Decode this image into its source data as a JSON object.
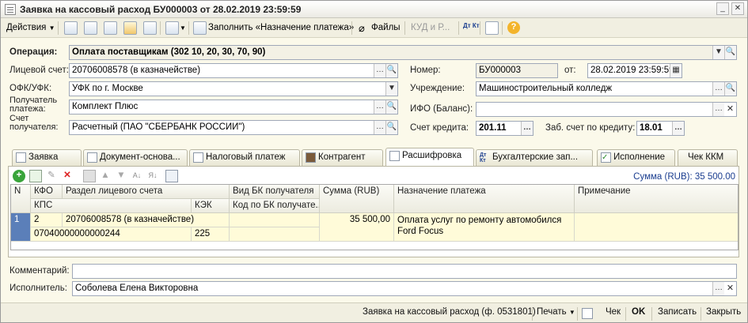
{
  "window": {
    "title": "Заявка на кассовый расход БУ000003 от 28.02.2019 23:59:59"
  },
  "toolbar": {
    "actions_label": "Действия",
    "fill_label": "Заполнить «Назначение платежа»",
    "files_label": "Файлы",
    "kud_label": "КУД и Р...",
    "dt_kt_label": "Дт Кт",
    "help_label": "?"
  },
  "form": {
    "operation_label": "Операция:",
    "operation_value": "Оплата поставщикам (302 10, 20, 30, 70, 90)",
    "account_label": "Лицевой счет:",
    "account_value": "20706008578 (в казначействе)",
    "number_label": "Номер:",
    "number_value": "БУ000003",
    "from_label": "от:",
    "date_value": "28.02.2019 23:59:59",
    "ofk_label": "ОФК/УФК:",
    "ofk_value": "УФК по г. Москве",
    "institution_label": "Учреждение:",
    "institution_value": "Машиностроительный колледж",
    "payee_label_1": "Получатель",
    "payee_label_2": "платежа:",
    "payee_value": "Комплект Плюс",
    "ifo_label": "ИФО (Баланс):",
    "ifo_value": "",
    "payee_acc_label_1": "Счет",
    "payee_acc_label_2": "получателя:",
    "payee_acc_value": "Расчетный (ПАО \"СБЕРБАНК РОССИИ\")",
    "credit_acc_label": "Счет кредита:",
    "credit_acc_value": "201.11",
    "zab_label": "Заб. счет по кредиту:",
    "zab_value": "18.01"
  },
  "tabs": [
    {
      "label": "Заявка"
    },
    {
      "label": "Документ-основа..."
    },
    {
      "label": "Налоговый платеж"
    },
    {
      "label": "Контрагент"
    },
    {
      "label": "Расшифровка"
    },
    {
      "label": "Бухгалтерские зап..."
    },
    {
      "label": "Исполнение"
    },
    {
      "label": "Чек ККМ"
    }
  ],
  "grid": {
    "sum_label": "Сумма (RUB): 35 500.00",
    "headers": {
      "n": "N",
      "kfo": "КФО",
      "section": "Раздел лицевого счета",
      "kps": "КПС",
      "kek": "КЭК",
      "vid_bk": "Вид БК получателя",
      "code_bk": "Код по БК получате...",
      "sum": "Сумма (RUB)",
      "purpose": "Назначение платежа",
      "note": "Примечание"
    },
    "rows": [
      {
        "n": "1",
        "kfo": "2",
        "section": "20706008578 (в казначействе)",
        "kps": "07040000000000244",
        "kek": "225",
        "vid_bk": "",
        "code_bk": "",
        "sum": "35 500,00",
        "purpose_1": "Оплата услуг по ремонту автомобился",
        "purpose_2": "Ford Focus",
        "note": ""
      }
    ]
  },
  "footer": {
    "comment_label": "Комментарий:",
    "comment_value": "",
    "executor_label": "Исполнитель:",
    "executor_value": "Соболева Елена Викторовна"
  },
  "statusbar": {
    "report_label": "Заявка на кассовый расход (ф. 0531801)",
    "print_label": "Печать",
    "check_label": "Чек",
    "ok_label": "OK",
    "save_label": "Записать",
    "close_label": "Закрыть"
  },
  "colors": {
    "accent": "#c0262c",
    "link": "#1a3d8f",
    "background": "#fbf9ea"
  }
}
